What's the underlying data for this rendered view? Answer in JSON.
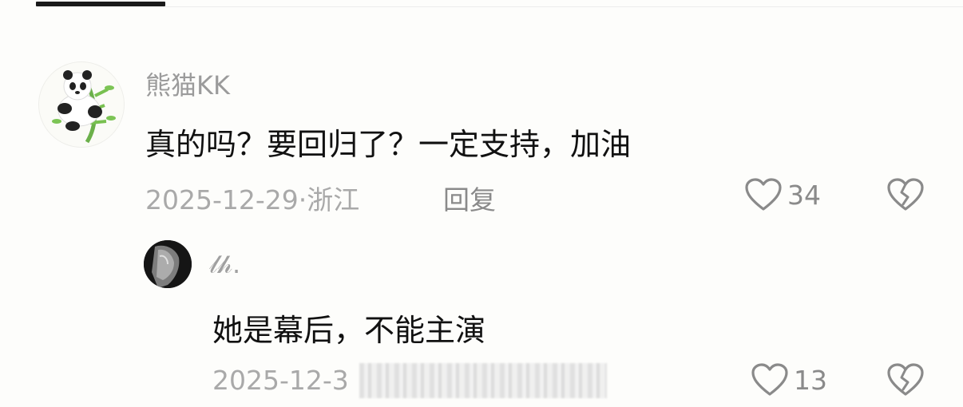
{
  "comment": {
    "username": "熊猫KK",
    "content": "真的吗？要回归了？一定支持，加油",
    "meta": "2025-12-29·浙江",
    "reply_label": "回复",
    "like_count": "34",
    "avatar_icon": "panda-avatar-icon"
  },
  "reply": {
    "username": "𝓁𝒽.",
    "content": "她是幕后，不能主演",
    "meta": "2025-12-3",
    "like_count": "13",
    "avatar_icon": "user-photo-avatar"
  },
  "colors": {
    "background": "#fdfdfb",
    "primary_text": "#111111",
    "secondary_text": "#9b9b9b",
    "icon": "#8a8a8a"
  }
}
